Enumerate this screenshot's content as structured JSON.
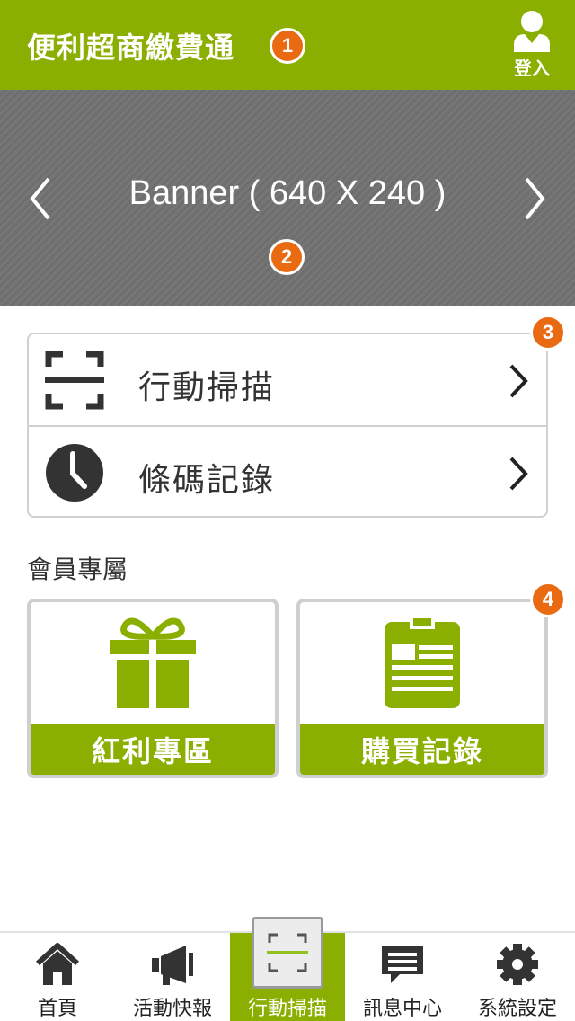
{
  "header": {
    "title": "便利超商繳費通",
    "title_badge": "1",
    "login_label": "登入"
  },
  "banner": {
    "text": "Banner ( 640 X 240 )",
    "badge": "2"
  },
  "menu": {
    "badge": "3",
    "items": [
      {
        "label": "行動掃描",
        "icon": "scan-icon"
      },
      {
        "label": "條碼記錄",
        "icon": "clock-icon"
      }
    ]
  },
  "member": {
    "section_title": "會員專屬",
    "badge": "4",
    "cards": [
      {
        "label": "紅利專區",
        "icon": "gift-icon"
      },
      {
        "label": "購買記錄",
        "icon": "clipboard-icon"
      }
    ]
  },
  "tabbar": {
    "active_index": 2,
    "items": [
      {
        "label": "首頁",
        "icon": "home-icon"
      },
      {
        "label": "活動快報",
        "icon": "megaphone-icon"
      },
      {
        "label": "行動掃描",
        "icon": "scan-icon"
      },
      {
        "label": "訊息中心",
        "icon": "message-icon"
      },
      {
        "label": "系統設定",
        "icon": "gear-icon"
      }
    ]
  },
  "colors": {
    "brand": "#8aaf00",
    "badge": "#ea6a12",
    "banner": "#737373",
    "icon_dark": "#333333"
  }
}
